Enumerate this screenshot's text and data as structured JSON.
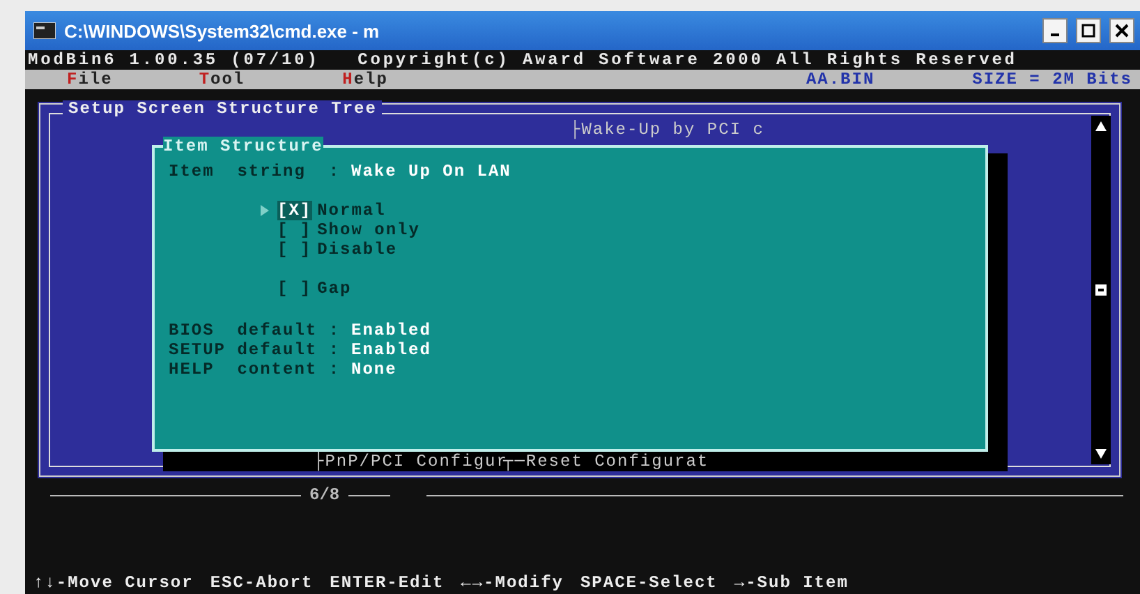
{
  "window": {
    "title": "C:\\WINDOWS\\System32\\cmd.exe - m"
  },
  "header": "ModBin6 1.00.35 (07/10)   Copyright(c) Award Software 2000 All Rights Reserved",
  "menu": [
    {
      "label": "File",
      "kind": "menu"
    },
    {
      "label": "Tool",
      "kind": "menu"
    },
    {
      "label": "Help",
      "kind": "menu"
    },
    {
      "label": "AA.BIN",
      "kind": "info"
    },
    {
      "label": "SIZE = 2M Bits",
      "kind": "info"
    }
  ],
  "tree": {
    "title": "Setup Screen Structure Tree",
    "top_node": "├Wake-Up by PCI c",
    "bottom_nodes": [
      "├PnP/PCI Configur",
      "┬─Reset Configurat"
    ],
    "page": "6/8"
  },
  "dialog": {
    "title": "Item Structure",
    "item_label": "Item  string  :",
    "item_value": "Wake Up On LAN",
    "options": [
      {
        "box": "[X]",
        "label": "Normal",
        "selected": true
      },
      {
        "box": "[ ]",
        "label": "Show only",
        "selected": false
      },
      {
        "box": "[ ]",
        "label": "Disable",
        "selected": false
      },
      {
        "box": "[ ]",
        "label": "Gap",
        "selected": false
      }
    ],
    "fields": [
      {
        "label": "BIOS  default :",
        "value": "Enabled"
      },
      {
        "label": "SETUP default :",
        "value": "Enabled"
      },
      {
        "label": "HELP  content :",
        "value": "None"
      }
    ]
  },
  "status_bar": [
    "↑↓-Move Cursor",
    "ESC-Abort",
    "ENTER-Edit",
    "←→-Modify",
    "SPACE-Select",
    "→-Sub Item"
  ]
}
